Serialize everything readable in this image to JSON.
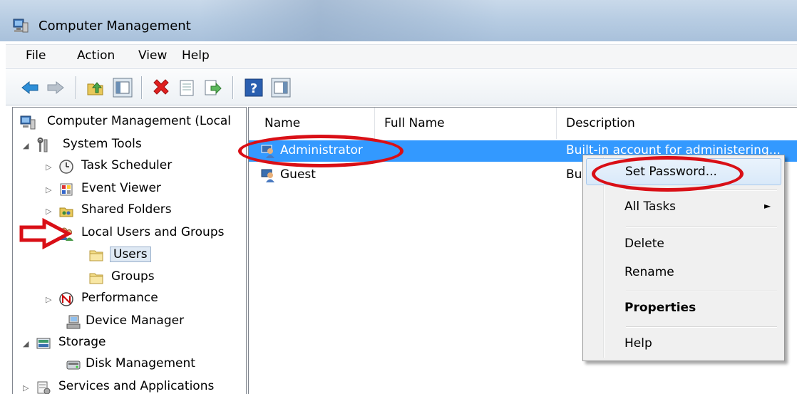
{
  "window": {
    "title": "Computer Management"
  },
  "menu": [
    "File",
    "Action",
    "View",
    "Help"
  ],
  "toolbar": {
    "buttons": [
      "back-icon",
      "forward-icon",
      "up-folder-icon",
      "show-hide-console-tree-icon",
      "delete-icon",
      "properties-icon",
      "export-list-icon",
      "help-icon",
      "show-hide-action-pane-icon"
    ]
  },
  "tree": {
    "root": "Computer Management (Local",
    "system_tools": "System Tools",
    "task_scheduler": "Task Scheduler",
    "event_viewer": "Event Viewer",
    "shared_folders": "Shared Folders",
    "local_users_groups": "Local Users and Groups",
    "users": "Users",
    "groups": "Groups",
    "performance": "Performance",
    "device_manager": "Device Manager",
    "storage": "Storage",
    "disk_management": "Disk Management",
    "services_apps": "Services and Applications"
  },
  "list": {
    "columns": [
      "Name",
      "Full Name",
      "Description"
    ],
    "rows": [
      {
        "name": "Administrator",
        "full_name": "",
        "description": "Built-in account for administering..."
      },
      {
        "name": "Guest",
        "full_name": "",
        "description": "Bu"
      }
    ]
  },
  "context_menu": {
    "set_password": "Set Password...",
    "all_tasks": "All Tasks",
    "submenu_arrow": "►",
    "delete": "Delete",
    "rename": "Rename",
    "properties": "Properties",
    "help": "Help"
  },
  "colors": {
    "selection": "#3399ff",
    "annotation_red": "#d90f16"
  }
}
